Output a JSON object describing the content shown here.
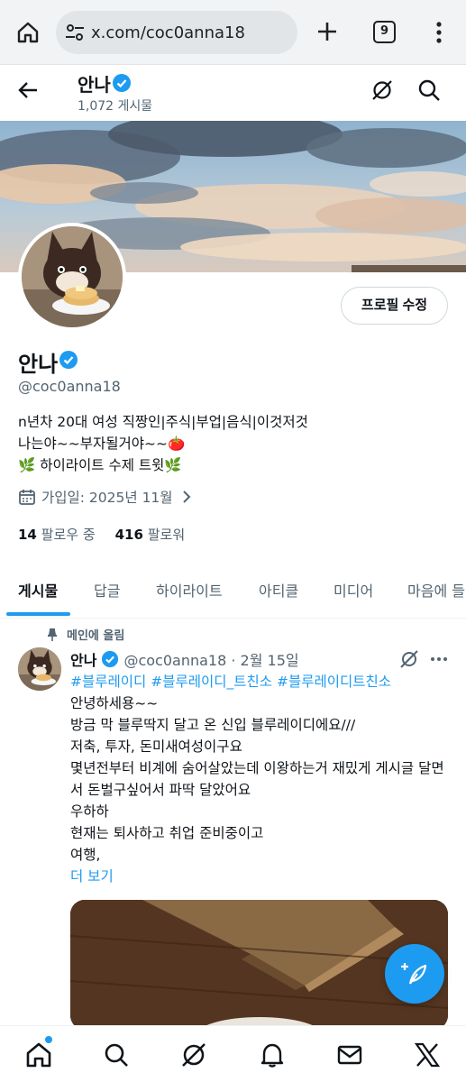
{
  "browser": {
    "url": "x.com/coc0anna18",
    "tab_count": "9"
  },
  "header": {
    "name": "안나",
    "post_count": "1,072 게시물"
  },
  "profile": {
    "name": "안나",
    "handle": "@coc0anna18",
    "edit_button": "프로필 수정",
    "bio": [
      "n년차 20대 여성 직짱인|주식|부업|음식|이것저것",
      "나는야~~부자될거야~~🍅",
      "🌿 하이라이트 수제 트윗🌿"
    ],
    "joined": "가입일: 2025년 11월",
    "following_count": "14",
    "following_label": "팔로우 중",
    "followers_count": "416",
    "followers_label": "팔로워"
  },
  "tabs": [
    "게시물",
    "답글",
    "하이라이트",
    "아티클",
    "미디어",
    "마음에 들"
  ],
  "pinned_post": {
    "pinned_label": "메인에 올림",
    "author": "안나",
    "handle": "@coc0anna18",
    "date": "· 2월 15일",
    "hashtags": "#블루레이디 #블루레이디_트친소 #블루레이디트친소",
    "lines": [
      "안녕하세용~~",
      "방금 막 블루딱지 달고 온 신입 블루레이디에요///",
      "저축, 투자, 돈미새여성이구요",
      "몇년전부터 비계에 숨어살았는데 이왕하는거 재밌게 게시글 달면서 돈벌구싶어서 파딱 달았어요",
      "우하하",
      "현재는 퇴사하고 취업 준비중이고",
      "여행,"
    ],
    "more_label": "더 보기"
  },
  "colors": {
    "accent": "#1d9bf0",
    "text": "#0f1419",
    "secondary": "#536471"
  }
}
